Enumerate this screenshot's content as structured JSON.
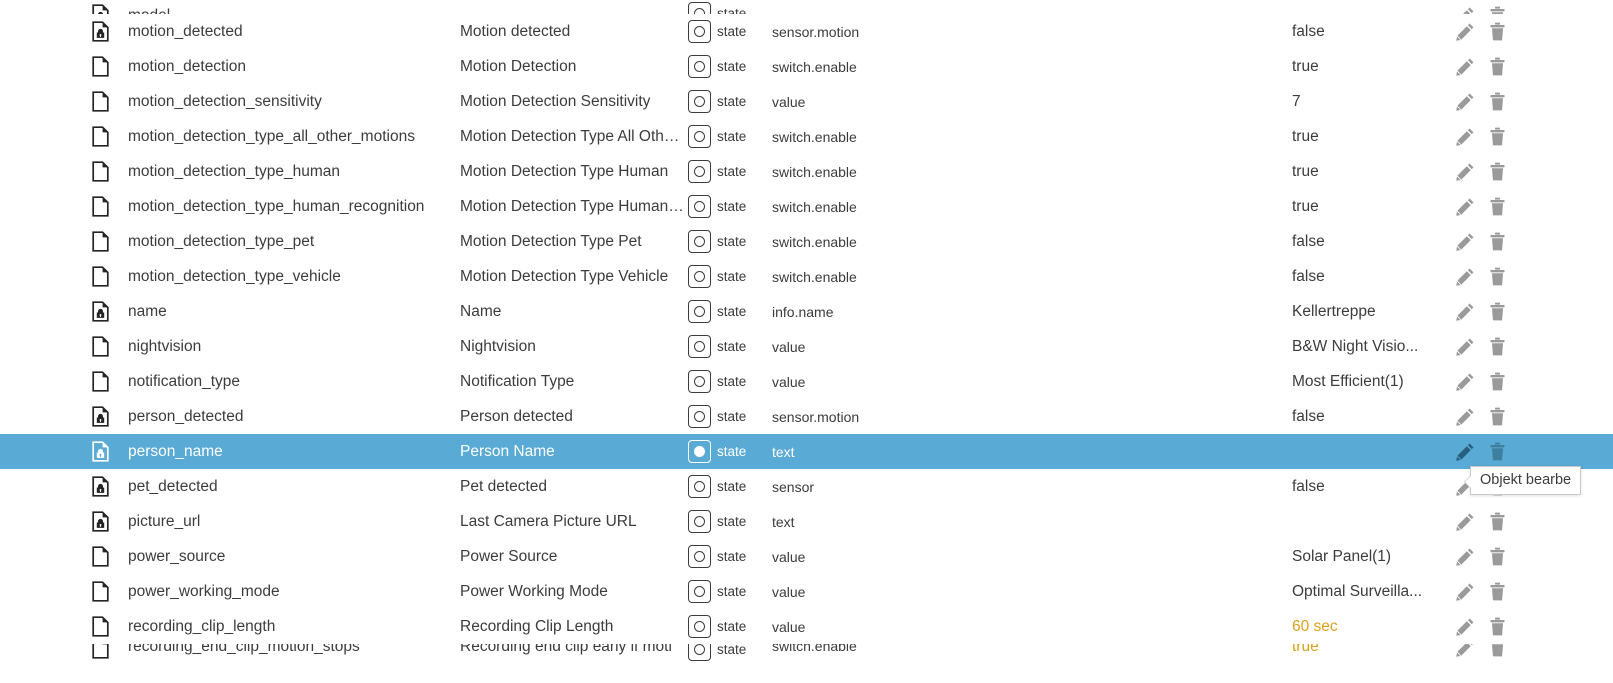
{
  "colors": {
    "selection_blue": "#5aaad6",
    "text": "#3c3c3c",
    "warn_value": "#d9a21b",
    "action_icon": "#9a9a9a"
  },
  "tooltip": {
    "text": "Objekt bearbe",
    "full_text_hint": "Objekt bearbe"
  },
  "badge": {
    "state_label": "state"
  },
  "icons": {
    "doc_locked": "document-locked-icon",
    "doc_plain": "document-icon",
    "edit": "pencil-icon",
    "delete": "trash-icon"
  },
  "rows": [
    {
      "id": "model",
      "name": "",
      "type": "",
      "value": "",
      "locked": true,
      "selected": false,
      "clipped": true,
      "partial": "top"
    },
    {
      "id": "motion_detected",
      "name": "Motion detected",
      "type": "sensor.motion",
      "value": "false",
      "locked": true,
      "selected": false
    },
    {
      "id": "motion_detection",
      "name": "Motion Detection",
      "type": "switch.enable",
      "value": "true",
      "locked": false,
      "selected": false
    },
    {
      "id": "motion_detection_sensitivity",
      "name": "Motion Detection Sensitivity",
      "type": "value",
      "value": "7",
      "locked": false,
      "selected": false
    },
    {
      "id": "motion_detection_type_all_other_motions",
      "name": "Motion Detection Type All Othe...",
      "type": "switch.enable",
      "value": "true",
      "locked": false,
      "selected": false
    },
    {
      "id": "motion_detection_type_human",
      "name": "Motion Detection Type Human",
      "type": "switch.enable",
      "value": "true",
      "locked": false,
      "selected": false
    },
    {
      "id": "motion_detection_type_human_recognition",
      "name": "Motion Detection Type Human ...",
      "type": "switch.enable",
      "value": "true",
      "locked": false,
      "selected": false
    },
    {
      "id": "motion_detection_type_pet",
      "name": "Motion Detection Type Pet",
      "type": "switch.enable",
      "value": "false",
      "locked": false,
      "selected": false
    },
    {
      "id": "motion_detection_type_vehicle",
      "name": "Motion Detection Type Vehicle",
      "type": "switch.enable",
      "value": "false",
      "locked": false,
      "selected": false
    },
    {
      "id": "name",
      "name": "Name",
      "type": "info.name",
      "value": "Kellertreppe",
      "locked": true,
      "selected": false
    },
    {
      "id": "nightvision",
      "name": "Nightvision",
      "type": "value",
      "value": "B&W Night Visio...",
      "locked": false,
      "selected": false
    },
    {
      "id": "notification_type",
      "name": "Notification Type",
      "type": "value",
      "value": "Most Efficient(1)",
      "locked": false,
      "selected": false
    },
    {
      "id": "person_detected",
      "name": "Person detected",
      "type": "sensor.motion",
      "value": "false",
      "locked": true,
      "selected": false
    },
    {
      "id": "person_name",
      "name": "Person Name",
      "type": "text",
      "value": "",
      "locked": true,
      "selected": true
    },
    {
      "id": "pet_detected",
      "name": "Pet detected",
      "type": "sensor",
      "value": "false",
      "locked": true,
      "selected": false
    },
    {
      "id": "picture_url",
      "name": "Last Camera Picture URL",
      "type": "text",
      "value": "",
      "locked": true,
      "selected": false
    },
    {
      "id": "power_source",
      "name": "Power Source",
      "type": "value",
      "value": "Solar Panel(1)",
      "locked": false,
      "selected": false
    },
    {
      "id": "power_working_mode",
      "name": "Power Working Mode",
      "type": "value",
      "value": "Optimal Surveilla...",
      "locked": false,
      "selected": false
    },
    {
      "id": "recording_clip_length",
      "name": "Recording Clip Length",
      "type": "value",
      "value": "60 sec",
      "value_warn": true,
      "locked": false,
      "selected": false
    },
    {
      "id": "recording_end_clip_motion_stops",
      "name": "Recording end clip early if moti",
      "type": "switch.enable",
      "value": "true",
      "value_warn": true,
      "locked": false,
      "selected": false,
      "partial": "bottom"
    }
  ]
}
